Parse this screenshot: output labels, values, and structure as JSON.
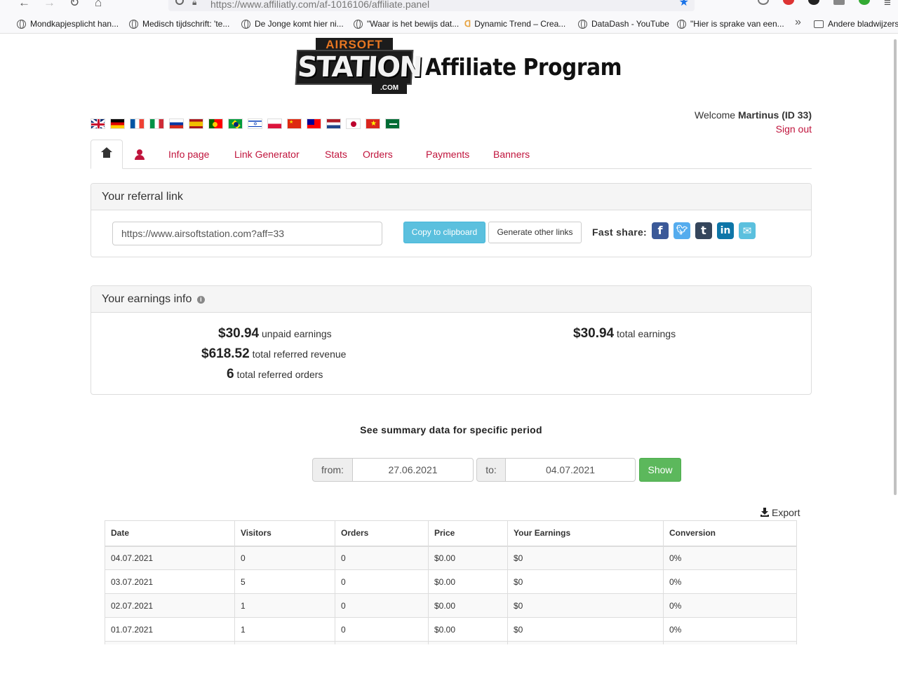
{
  "browser": {
    "url": "https://www.affiliatly.com/af-1016106/affiliate.panel",
    "bookmarks": [
      "Mondkapjesplicht han...",
      "Medisch tijdschrift: 'te...",
      "De Jonge komt hier ni...",
      "\"Waar is het bewijs dat...",
      "Dynamic Trend – Crea...",
      "DataDash - YouTube",
      "\"Hier is sprake van een...",
      "Andere bladwijzers"
    ]
  },
  "header": {
    "logo_top": "AIRSOFT",
    "logo_main": "STATION",
    "logo_domain": ".COM",
    "title": "Affiliate Program"
  },
  "user": {
    "welcome_prefix": "Welcome",
    "name_id": "Martinus (ID 33)",
    "signout": "Sign out"
  },
  "tabs": [
    "Info page",
    "Link Generator",
    "Stats",
    "Orders",
    "Payments",
    "Banners"
  ],
  "referral": {
    "heading": "Your referral link",
    "link": "https://www.airsoftstation.com?aff=33",
    "copy_label": "Copy to clipboard",
    "generate_label": "Generate other links",
    "fast_share": "Fast share:"
  },
  "earnings": {
    "heading": "Your earnings info",
    "unpaid_value": "$30.94",
    "unpaid_label": "unpaid earnings",
    "revenue_value": "$618.52",
    "revenue_label": "total referred revenue",
    "orders_value": "6",
    "orders_label": "total referred orders",
    "total_value": "$30.94",
    "total_label": "total earnings"
  },
  "period": {
    "title": "See summary data for specific period",
    "from_label": "from:",
    "from_value": "27.06.2021",
    "to_label": "to:",
    "to_value": "04.07.2021",
    "show_label": "Show",
    "export_label": "Export"
  },
  "table": {
    "columns": [
      "Date",
      "Visitors",
      "Orders",
      "Price",
      "Your Earnings",
      "Conversion"
    ],
    "rows": [
      [
        "04.07.2021",
        "0",
        "0",
        "$0.00",
        "$0",
        "0%"
      ],
      [
        "03.07.2021",
        "5",
        "0",
        "$0.00",
        "$0",
        "0%"
      ],
      [
        "02.07.2021",
        "1",
        "0",
        "$0.00",
        "$0",
        "0%"
      ],
      [
        "01.07.2021",
        "1",
        "0",
        "$0.00",
        "$0",
        "0%"
      ],
      [
        "",
        "",
        "",
        "",
        "",
        ""
      ]
    ]
  },
  "colors": {
    "link": "#c0143c",
    "info_button": "#5bc0de",
    "success_button": "#5cb85c",
    "facebook": "#3b5998",
    "twitter": "#55acee",
    "tumblr": "#35465c",
    "linkedin": "#0e76a8",
    "email": "#5bc0de"
  },
  "icons": [
    "home-icon",
    "user-icon",
    "info-icon",
    "facebook-icon",
    "twitter-icon",
    "tumblr-icon",
    "linkedin-icon",
    "email-icon",
    "download-icon"
  ]
}
